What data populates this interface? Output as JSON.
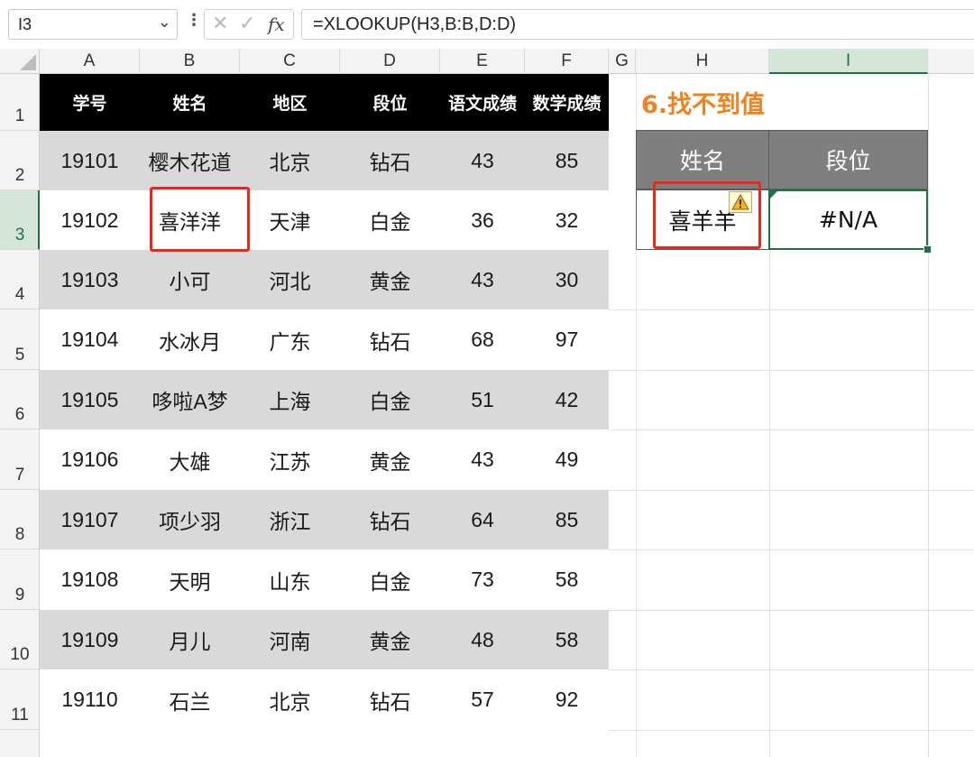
{
  "formula_bar": {
    "name_box": "I3",
    "caret": "⌄",
    "menu_dots": "⋮",
    "cancel_icon": "✕",
    "enter_icon": "✓",
    "fx_label": "fx",
    "formula": "=XLOOKUP(H3,B:B,D:D)"
  },
  "columns": [
    "A",
    "B",
    "C",
    "D",
    "E",
    "F",
    "G",
    "H",
    "I"
  ],
  "rows": [
    "1",
    "2",
    "3",
    "4",
    "5",
    "6",
    "7",
    "8",
    "9",
    "10",
    "11"
  ],
  "selected": {
    "column": "I",
    "row": "3"
  },
  "table": {
    "headers": [
      "学号",
      "姓名",
      "地区",
      "段位",
      "语文成绩",
      "数学成绩"
    ],
    "records": [
      [
        "19101",
        "樱木花道",
        "北京",
        "钻石",
        "43",
        "85"
      ],
      [
        "19102",
        "喜洋洋",
        "天津",
        "白金",
        "36",
        "32"
      ],
      [
        "19103",
        "小可",
        "河北",
        "黄金",
        "43",
        "30"
      ],
      [
        "19104",
        "水冰月",
        "广东",
        "钻石",
        "68",
        "97"
      ],
      [
        "19105",
        "哆啦A梦",
        "上海",
        "白金",
        "51",
        "42"
      ],
      [
        "19106",
        "大雄",
        "江苏",
        "黄金",
        "43",
        "49"
      ],
      [
        "19107",
        "项少羽",
        "浙江",
        "钻石",
        "64",
        "85"
      ],
      [
        "19108",
        "天明",
        "山东",
        "白金",
        "73",
        "58"
      ],
      [
        "19109",
        "月儿",
        "河南",
        "黄金",
        "48",
        "58"
      ],
      [
        "19110",
        "石兰",
        "北京",
        "钻石",
        "57",
        "92"
      ]
    ]
  },
  "lookup": {
    "title": "6.找不到值",
    "headers": [
      "姓名",
      "段位"
    ],
    "values": [
      "喜羊羊",
      "#N/A"
    ]
  },
  "colors": {
    "header_bg": "#000000",
    "band_bg": "#d9d9d9",
    "title_orange": "#f0821e",
    "highlight_red": "#e8271f",
    "lookup_header_bg": "#7f7f7f",
    "selection_green": "#1e7145"
  },
  "icons": {
    "warning": "warning-icon"
  }
}
